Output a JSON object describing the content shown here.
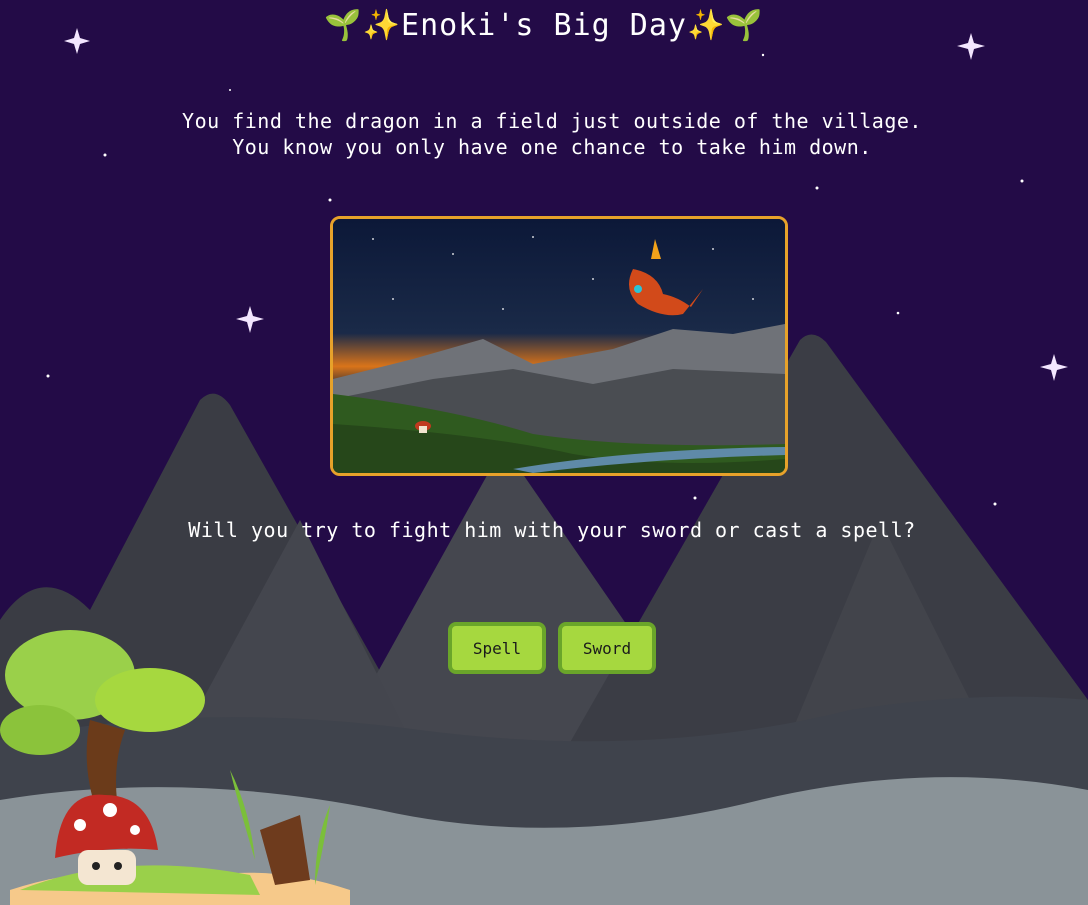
{
  "game": {
    "title": "🌱✨Enoki's Big Day✨🌱",
    "narration": "You find the dragon in a field just outside of the village. You know you only have one chance to take him down.",
    "question": "Will you try to fight him with your sword or cast a spell?",
    "choices": [
      {
        "label": "Spell"
      },
      {
        "label": "Sword"
      }
    ]
  },
  "colors": {
    "sky": "#230b47",
    "mountain": "#3b3d45",
    "ground": "#8a9398",
    "button": "#a6d83f",
    "button_border": "#6aa52a",
    "frame_border": "#e7a22a"
  }
}
